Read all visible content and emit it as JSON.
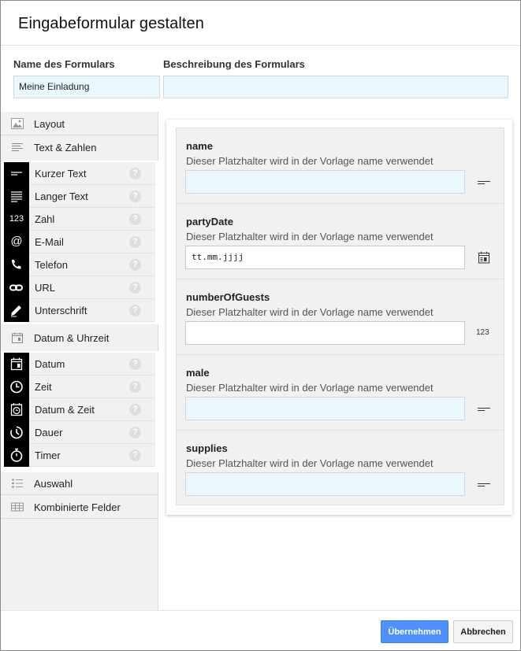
{
  "dialog": {
    "title": "Eingabeformular gestalten",
    "form_name_label": "Name des Formulars",
    "form_name_value": "Meine Einladung",
    "form_desc_label": "Beschreibung des Formulars",
    "form_desc_value": ""
  },
  "sidebar": {
    "categories": [
      {
        "label": "Layout",
        "icon": "image-icon"
      },
      {
        "label": "Text & Zahlen",
        "icon": "text-lines-icon"
      },
      {
        "label": "Datum & Uhrzeit",
        "icon": "calendar-icon"
      },
      {
        "label": "Auswahl",
        "icon": "list-icon"
      },
      {
        "label": "Kombinierte Felder",
        "icon": "table-icon"
      }
    ],
    "text_items": [
      {
        "label": "Kurzer Text",
        "icon": "short-text-icon"
      },
      {
        "label": "Langer Text",
        "icon": "long-text-icon"
      },
      {
        "label": "Zahl",
        "icon": "number-icon",
        "glyph": "123"
      },
      {
        "label": "E-Mail",
        "icon": "at-icon",
        "glyph": "@"
      },
      {
        "label": "Telefon",
        "icon": "phone-icon"
      },
      {
        "label": "URL",
        "icon": "link-icon"
      },
      {
        "label": "Unterschrift",
        "icon": "pen-icon"
      }
    ],
    "date_items": [
      {
        "label": "Datum",
        "icon": "calendar-icon"
      },
      {
        "label": "Zeit",
        "icon": "clock-icon"
      },
      {
        "label": "Datum & Zeit",
        "icon": "alarm-clock-icon"
      },
      {
        "label": "Dauer",
        "icon": "duration-icon"
      },
      {
        "label": "Timer",
        "icon": "stopwatch-icon"
      }
    ],
    "help_glyph": "?"
  },
  "fields": [
    {
      "name": "name",
      "description": "Dieser Platzhalter wird in der Vorlage name verwendet",
      "value": "",
      "type_icon": "short-text-icon"
    },
    {
      "name": "partyDate",
      "description": "Dieser Platzhalter wird in der Vorlage name verwendet",
      "value": "tt.mm.jjjj",
      "type_icon": "calendar-icon"
    },
    {
      "name": "numberOfGuests",
      "description": "Dieser Platzhalter wird in der Vorlage name verwendet",
      "value": "",
      "type_icon": "number-icon",
      "type_glyph": "123"
    },
    {
      "name": "male",
      "description": "Dieser Platzhalter wird in der Vorlage name verwendet",
      "value": "",
      "type_icon": "short-text-icon"
    },
    {
      "name": "supplies",
      "description": "Dieser Platzhalter wird in der Vorlage name verwendet",
      "value": "",
      "type_icon": "short-text-icon"
    }
  ],
  "footer": {
    "apply_label": "Übernehmen",
    "cancel_label": "Abbrechen"
  },
  "colors": {
    "primary": "#4d90fe",
    "input_bg": "#eaf8fe",
    "sidebar_bg": "#f1f1f1"
  }
}
